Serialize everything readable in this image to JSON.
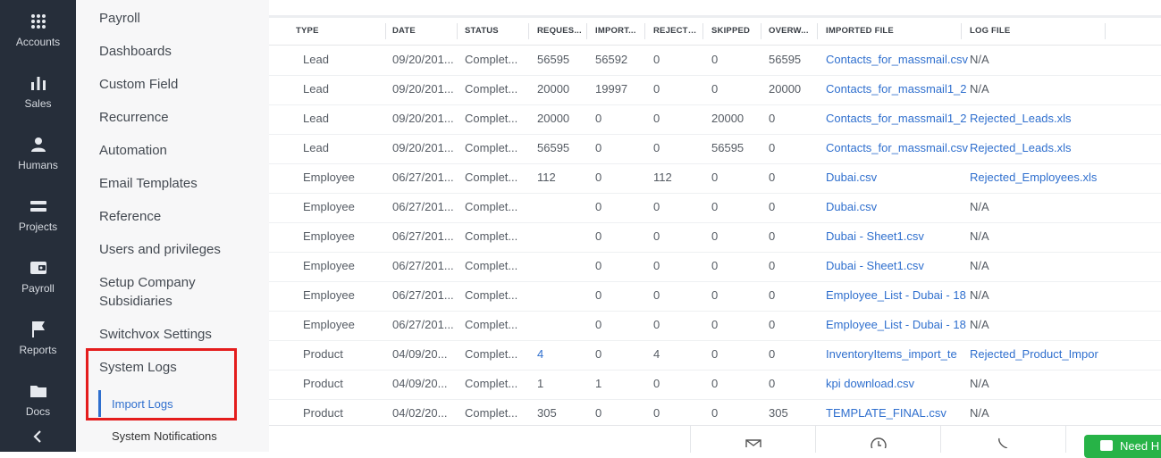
{
  "rail": {
    "items": [
      {
        "label": "Accounts",
        "icon": "grid-icon"
      },
      {
        "label": "Sales",
        "icon": "bar-chart-icon"
      },
      {
        "label": "Humans",
        "icon": "person-icon"
      },
      {
        "label": "Projects",
        "icon": "stack-icon"
      },
      {
        "label": "Payroll",
        "icon": "wallet-icon"
      },
      {
        "label": "Reports",
        "icon": "flag-icon"
      },
      {
        "label": "Docs",
        "icon": "folder-icon"
      }
    ],
    "collapse_icon": "chevron-left-icon"
  },
  "submenu": {
    "items": [
      "Payroll",
      "Dashboards",
      "Custom Field",
      "Recurrence",
      "Automation",
      "Email Templates",
      "Reference",
      "Users and privileges",
      "Setup Company Subsidiaries",
      "Switchvox Settings",
      "System Logs"
    ],
    "sub_items": [
      "Import Logs",
      "System Notifications"
    ],
    "active_sub": "Import Logs",
    "highlight_color": "#e41d1d"
  },
  "table": {
    "headers": [
      "TYPE",
      "DATE",
      "STATUS",
      "REQUESTED",
      "IMPORTED",
      "REJECTED",
      "SKIPPED",
      "OVERWRITTEN",
      "IMPORTED FILE",
      "LOG FILE"
    ],
    "header_display": [
      "TYPE",
      "DATE",
      "STATUS",
      "REQUES...",
      "IMPORT...",
      "REJECTE...",
      "SKIPPED",
      "OVERW...",
      "IMPORTED FILE",
      "LOG FILE"
    ],
    "rows": [
      [
        "Lead",
        "09/20/201...",
        "Complet...",
        "56595",
        "56592",
        "0",
        "0",
        "56595",
        "Contacts_for_massmail.csv",
        "N/A"
      ],
      [
        "Lead",
        "09/20/201...",
        "Complet...",
        "20000",
        "19997",
        "0",
        "0",
        "20000",
        "Contacts_for_massmail1_2",
        "N/A"
      ],
      [
        "Lead",
        "09/20/201...",
        "Complet...",
        "20000",
        "0",
        "0",
        "20000",
        "0",
        "Contacts_for_massmail1_2",
        "Rejected_Leads.xls"
      ],
      [
        "Lead",
        "09/20/201...",
        "Complet...",
        "56595",
        "0",
        "0",
        "56595",
        "0",
        "Contacts_for_massmail.csv",
        "Rejected_Leads.xls"
      ],
      [
        "Employee",
        "06/27/201...",
        "Complet...",
        "112",
        "0",
        "112",
        "0",
        "0",
        "Dubai.csv",
        "Rejected_Employees.xls"
      ],
      [
        "Employee",
        "06/27/201...",
        "Complet...",
        "",
        "0",
        "0",
        "0",
        "0",
        "Dubai.csv",
        "N/A"
      ],
      [
        "Employee",
        "06/27/201...",
        "Complet...",
        "",
        "0",
        "0",
        "0",
        "0",
        "Dubai - Sheet1.csv",
        "N/A"
      ],
      [
        "Employee",
        "06/27/201...",
        "Complet...",
        "",
        "0",
        "0",
        "0",
        "0",
        "Dubai - Sheet1.csv",
        "N/A"
      ],
      [
        "Employee",
        "06/27/201...",
        "Complet...",
        "",
        "0",
        "0",
        "0",
        "0",
        "Employee_List - Dubai - 18",
        "N/A"
      ],
      [
        "Employee",
        "06/27/201...",
        "Complet...",
        "",
        "0",
        "0",
        "0",
        "0",
        "Employee_List - Dubai - 18",
        "N/A"
      ],
      [
        "Product",
        "04/09/20...",
        "Complet...",
        "4",
        "0",
        "4",
        "0",
        "0",
        "InventoryItems_import_te",
        "Rejected_Product_Impor"
      ],
      [
        "Product",
        "04/09/20...",
        "Complet...",
        "1",
        "1",
        "0",
        "0",
        "0",
        "kpi download.csv",
        "N/A"
      ],
      [
        "Product",
        "04/02/20...",
        "Complet...",
        "305",
        "0",
        "0",
        "0",
        "305",
        "TEMPLATE_FINAL.csv",
        "N/A"
      ]
    ]
  },
  "bottombar": {
    "icons": [
      "mail-icon",
      "clock-icon",
      "phone-icon"
    ],
    "help_label": "Need H",
    "help_color": "#27b347"
  }
}
